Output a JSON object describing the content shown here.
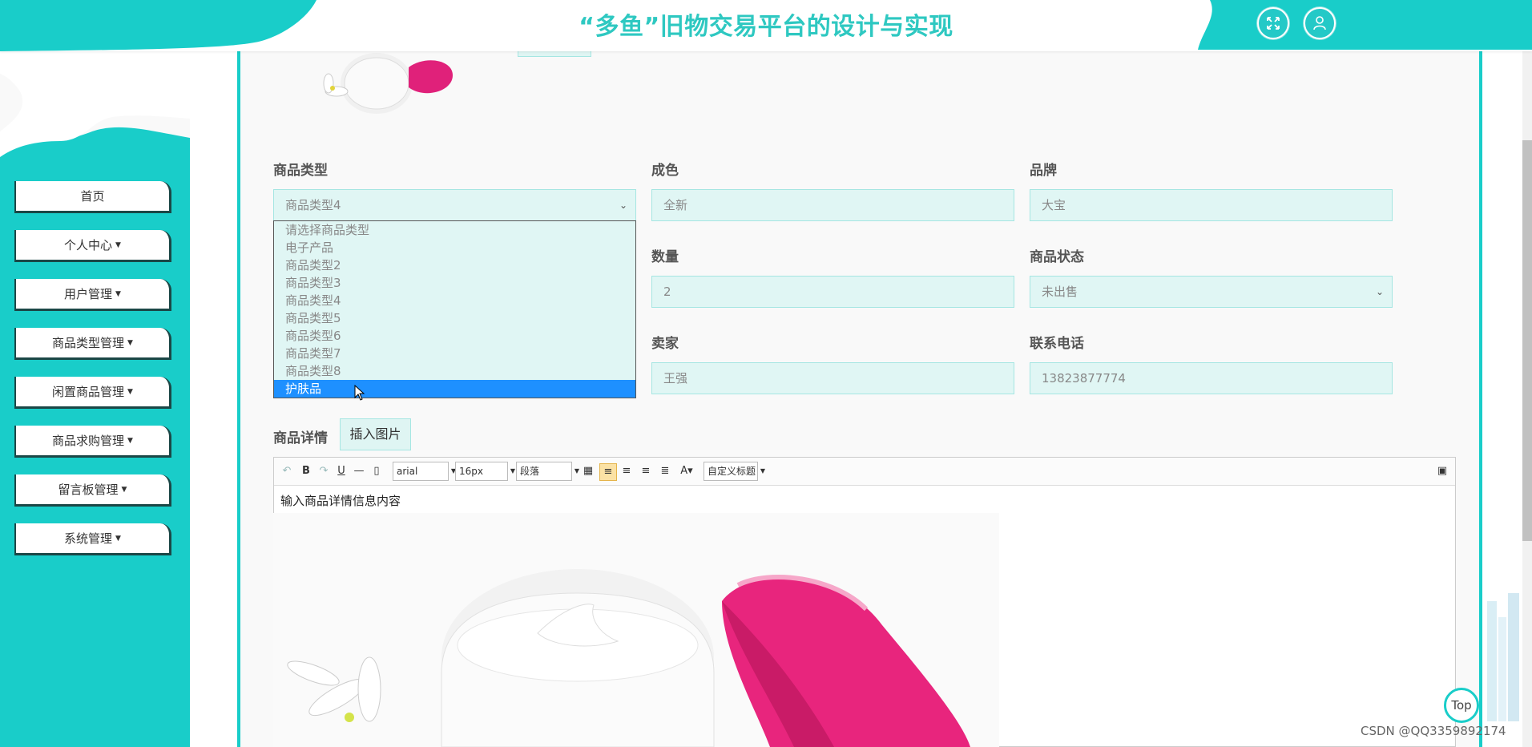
{
  "header": {
    "title": "“多鱼”旧物交易平台的设计与实现",
    "fullscreen_icon": "fullscreen-icon",
    "user_icon": "user-icon"
  },
  "sidebar": {
    "items": [
      {
        "label": "首页",
        "has_caret": false
      },
      {
        "label": "个人中心",
        "has_caret": true
      },
      {
        "label": "用户管理",
        "has_caret": true
      },
      {
        "label": "商品类型管理",
        "has_caret": true
      },
      {
        "label": "闲置商品管理",
        "has_caret": true
      },
      {
        "label": "商品求购管理",
        "has_caret": true
      },
      {
        "label": "留言板管理",
        "has_caret": true
      },
      {
        "label": "系统管理",
        "has_caret": true
      }
    ]
  },
  "form": {
    "category_label": "商品类型",
    "category_value": "商品类型4",
    "condition_label": "成色",
    "condition_value": "全新",
    "brand_label": "品牌",
    "brand_value": "大宝",
    "quantity_label": "数量",
    "quantity_value": "2",
    "status_label": "商品状态",
    "status_value": "未出售",
    "seller_label": "卖家",
    "seller_value": "王强",
    "phone_label": "联系电话",
    "phone_value": "13823877774",
    "details_label": "商品详情",
    "insert_image_button": "插入图片"
  },
  "category_dropdown": {
    "options": [
      "请选择商品类型",
      "电子产品",
      "商品类型2",
      "商品类型3",
      "商品类型4",
      "商品类型5",
      "商品类型6",
      "商品类型7",
      "商品类型8",
      "护肤品"
    ],
    "highlighted": "护肤品"
  },
  "editor": {
    "toolbar": {
      "font_family": "arial",
      "font_size": "16px",
      "paragraph": "段落",
      "custom_heading": "自定义标题"
    },
    "content_text": "输入商品详情信息内容"
  },
  "colors": {
    "accent": "#19cdc9",
    "field_bg": "#e0f6f4",
    "selected_option": "#1e90ff"
  },
  "to_top_label": "Top",
  "watermark": "CSDN @QQ3359892174"
}
